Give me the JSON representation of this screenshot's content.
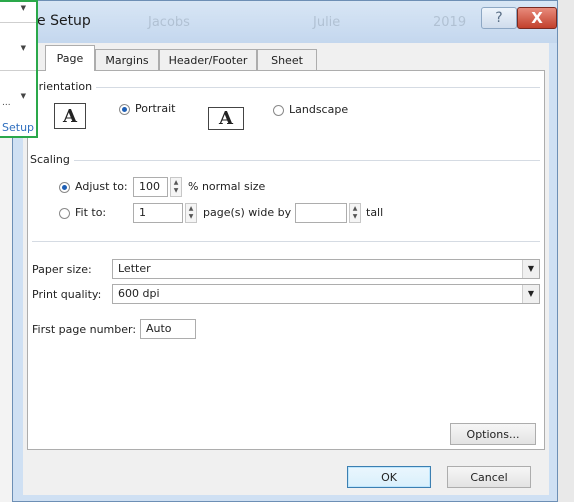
{
  "dialog": {
    "title": "e Setup",
    "background_text": [
      "Jacobs",
      "Julie",
      "2019"
    ],
    "help_label": "?",
    "close_label": "X"
  },
  "left_strip": {
    "link_label": "Setup",
    "dots": "..."
  },
  "tabs": [
    "Page",
    "Margins",
    "Header/Footer",
    "Sheet"
  ],
  "orientation": {
    "group_label": "Orientation",
    "icon_letter": "A",
    "portrait_label": "Portrait",
    "landscape_label": "Landscape",
    "selected": "Portrait"
  },
  "scaling": {
    "group_label": "Scaling",
    "adjust_label": "Adjust to:",
    "adjust_value": "100",
    "adjust_suffix": "% normal size",
    "fit_label": "Fit to:",
    "fit_wide_value": "1",
    "fit_wide_suffix": "page(s) wide by",
    "fit_tall_value": "",
    "fit_tall_suffix": "tall",
    "selected": "Adjust to"
  },
  "paper_size": {
    "label": "Paper size:",
    "value": "Letter"
  },
  "print_quality": {
    "label": "Print quality:",
    "value": "600 dpi"
  },
  "first_page": {
    "label": "First page number:",
    "value": "Auto"
  },
  "buttons": {
    "options": "Options...",
    "ok": "OK",
    "cancel": "Cancel"
  },
  "colors": {
    "accent": "#1e5fb5",
    "titlebar": "#c4d7ee",
    "close": "#c2402c",
    "highlight": "#2aa84a"
  }
}
